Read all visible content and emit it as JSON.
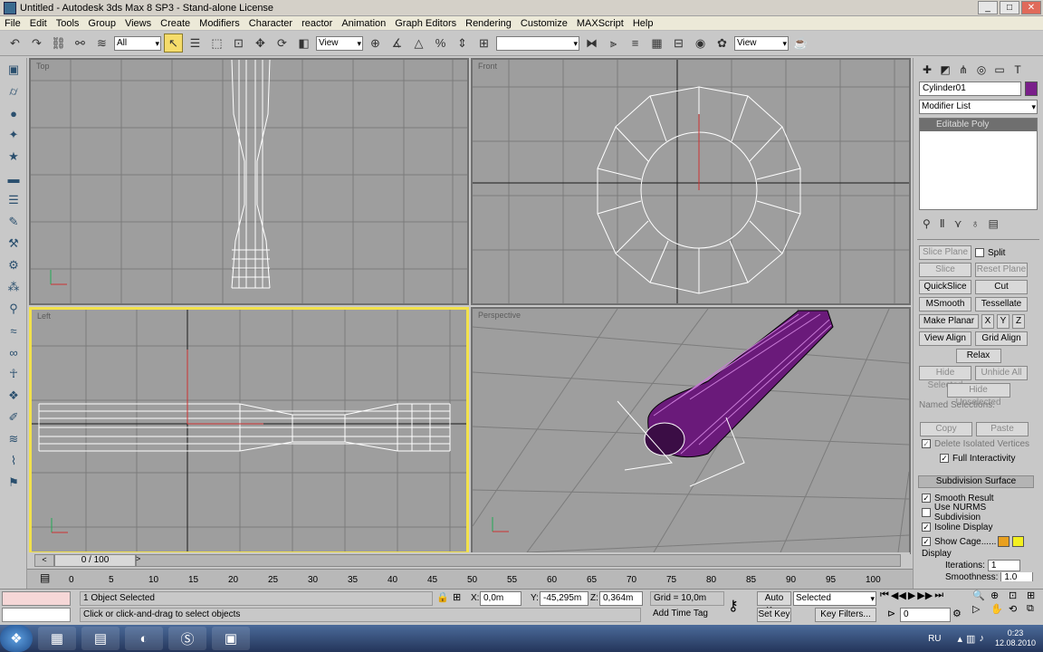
{
  "window": {
    "title": "Untitled - Autodesk 3ds Max 8 SP3 - Stand-alone License",
    "min": "_",
    "max": "□",
    "close": "✕"
  },
  "menu": [
    "File",
    "Edit",
    "Tools",
    "Group",
    "Views",
    "Create",
    "Modifiers",
    "Character",
    "reactor",
    "Animation",
    "Graph Editors",
    "Rendering",
    "Customize",
    "MAXScript",
    "Help"
  ],
  "toolbar": {
    "selection_filter": "All",
    "ref_coord": "View",
    "named_sel": "",
    "view_dd": "View"
  },
  "viewports": {
    "top_left": {
      "label": "Top"
    },
    "top_right": {
      "label": "Front"
    },
    "bottom_left": {
      "label": "Left"
    },
    "bottom_right": {
      "label": "Perspective"
    }
  },
  "command_panel": {
    "object_name": "Cylinder01",
    "object_color": "#7a1f8a",
    "modifier_list": "Modifier List",
    "stack_item": "Editable Poly",
    "buttons": {
      "slice_plane": "Slice Plane",
      "split": "Split",
      "slice": "Slice",
      "reset_plane": "Reset Plane",
      "quickslice": "QuickSlice",
      "cut": "Cut",
      "msmooth": "MSmooth",
      "tessellate": "Tessellate",
      "make_planar": "Make Planar",
      "x": "X",
      "y": "Y",
      "z": "Z",
      "view_align": "View Align",
      "grid_align": "Grid Align",
      "relax": "Relax",
      "hide_selected": "Hide Selected",
      "unhide_all": "Unhide All",
      "hide_unselected": "Hide Unselected",
      "named_selections": "Named Selections:",
      "copy": "Copy",
      "paste": "Paste",
      "delete_isolated": "Delete Isolated Vertices",
      "full_interactivity": "Full Interactivity"
    },
    "subdivision": {
      "header": "Subdivision Surface",
      "smooth_result": "Smooth Result",
      "use_nurms": "Use NURMS Subdivision",
      "isoline": "Isoline Display",
      "show_cage": "Show Cage......",
      "display_label": "Display",
      "iterations_label": "Iterations:",
      "iterations": "1",
      "smoothness_label": "Smoothness:",
      "smoothness": "1.0",
      "cage_color1": "#e8a020",
      "cage_color2": "#f3f020"
    }
  },
  "timeslider": {
    "frame": "0 / 100"
  },
  "trackbar": {
    "ticks": [
      "0",
      "5",
      "10",
      "15",
      "20",
      "25",
      "30",
      "35",
      "40",
      "45",
      "50",
      "55",
      "60",
      "65",
      "70",
      "75",
      "80",
      "85",
      "90",
      "95",
      "100"
    ]
  },
  "status": {
    "objects_selected": "1 Object Selected",
    "prompt": "Click or click-and-drag to select objects",
    "x_label": "X:",
    "x": "0,0m",
    "y_label": "Y:",
    "y": "-45,295m",
    "z_label": "Z:",
    "z": "0,364m",
    "grid": "Grid = 10,0m",
    "add_time_tag": "Add Time Tag",
    "auto_key": "Auto Key",
    "set_key": "Set Key",
    "key_mode": "Selected",
    "key_filters": "Key Filters...",
    "frame_field": "0"
  },
  "taskbar": {
    "lang": "RU",
    "time": "0:23",
    "date": "12.08.2010"
  }
}
